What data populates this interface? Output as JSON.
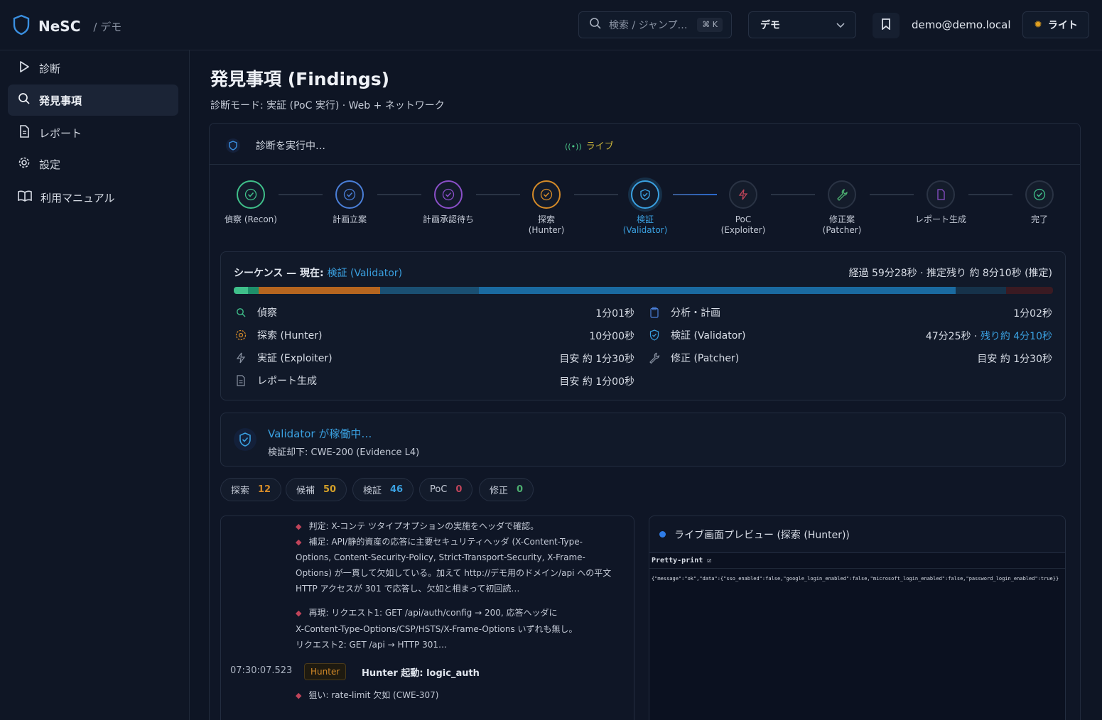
{
  "brand": {
    "name": "NeSC",
    "crumb": "/ デモ"
  },
  "search": {
    "placeholder": "検索 / ジャンプ…",
    "shortcut": "⌘ K"
  },
  "env": {
    "selected": "デモ"
  },
  "user": {
    "email": "demo@demo.local"
  },
  "theme": {
    "label": "ライト"
  },
  "sidebar": {
    "items": [
      {
        "label": "診断",
        "icon": "play-icon"
      },
      {
        "label": "発見事項",
        "icon": "search-icon",
        "active": true
      },
      {
        "label": "レポート",
        "icon": "document-icon"
      },
      {
        "label": "設定",
        "icon": "gear-icon"
      },
      {
        "label": "利用マニュアル",
        "icon": "book-icon"
      }
    ]
  },
  "page": {
    "title": "発見事項 (Findings)",
    "subtitle": "診断モード: 実証 (PoC 実行) · Web + ネットワーク"
  },
  "run": {
    "title": "診断を実行中…",
    "live_label": "ライブ"
  },
  "steps": [
    {
      "label": "偵察 (Recon)",
      "state": "done",
      "color": "#3fbf8a"
    },
    {
      "label": "計画立案",
      "state": "done",
      "color": "#4a7fd8"
    },
    {
      "label": "計画承認待ち",
      "state": "done",
      "color": "#8a4fc8"
    },
    {
      "label": "探索\n(Hunter)",
      "state": "done",
      "color": "#d48a28"
    },
    {
      "label": "検証\n(Validator)",
      "state": "active",
      "color": "#3aa0e0"
    },
    {
      "label": "PoC\n(Exploiter)",
      "state": "pending",
      "color": "#c0445a"
    },
    {
      "label": "修正案\n(Patcher)",
      "state": "pending",
      "color": "#4caf70"
    },
    {
      "label": "レポート生成",
      "state": "pending",
      "color": "#8a4fc8"
    },
    {
      "label": "完了",
      "state": "pending",
      "color": "#3fbf8a"
    }
  ],
  "sequence": {
    "title_prefix": "シーケンス — 現在:",
    "current": "検証 (Validator)",
    "elapsed": "経過 59分28秒 · 推定残り 約 8分10秒 (推定)",
    "segments": [
      {
        "color": "#3fbf8a",
        "share": 0.017
      },
      {
        "color": "#1d8f6a",
        "share": 0.013
      },
      {
        "color": "#b5651f",
        "share": 0.149
      },
      {
        "color": "#1a4f72",
        "share": 0.12
      },
      {
        "color": "#1a6aa0",
        "share": 0.582
      },
      {
        "color": "#16324a",
        "share": 0.062
      },
      {
        "color": "#3a1a22",
        "share": 0.057
      }
    ],
    "phases_left": [
      {
        "label": "偵察",
        "icon": "search-icon",
        "color": "#3fbf8a",
        "duration": "1分01秒"
      },
      {
        "label": "探索 (Hunter)",
        "icon": "radar-icon",
        "color": "#d48a28",
        "duration": "10分00秒"
      },
      {
        "label": "実証 (Exploiter)",
        "icon": "bolt-icon",
        "color": "#8a93a3",
        "duration": "目安 約 1分30秒"
      },
      {
        "label": "レポート生成",
        "icon": "document-icon",
        "color": "#8a93a3",
        "duration": "目安 約 1分00秒"
      }
    ],
    "phases_right": [
      {
        "label": "分析・計画",
        "icon": "clipboard-icon",
        "color": "#4a7fd8",
        "duration": "1分02秒"
      },
      {
        "label": "検証 (Validator)",
        "icon": "shield-icon",
        "color": "#3aa0e0",
        "duration": "47分25秒 · ",
        "remaining": "残り約 4分10秒"
      },
      {
        "label": "修正 (Patcher)",
        "icon": "wrench-icon",
        "color": "#8a93a3",
        "duration": "目安 約 1分30秒"
      }
    ]
  },
  "validator": {
    "title": "Validator が稼働中…",
    "sub": "検証却下: CWE-200 (Evidence L4)"
  },
  "counters": [
    {
      "label": "探索",
      "value": "12",
      "color": "#d48a28"
    },
    {
      "label": "候補",
      "value": "50",
      "color": "#d4a028"
    },
    {
      "label": "検証",
      "value": "46",
      "color": "#3aa0e0"
    },
    {
      "label": "PoC",
      "value": "0",
      "color": "#c0445a"
    },
    {
      "label": "修正",
      "value": "0",
      "color": "#4caf70"
    }
  ],
  "log": {
    "lines": [
      "判定: X-コンテ ツタイプオプションの実施をヘッダで確認。",
      "補足: API/静的資産の応答に主要セキュリティヘッダ (X-Content-Type-",
      "Options, Content-Security-Policy, Strict-Transport-Security, X-Frame-",
      "Options) が一貫して欠如している。加えて http://デモ用のドメイン/api への平文",
      "HTTP アクセスが 301 で応答し、欠如と相まって初回読…",
      "再現: リクエスト1: GET /api/auth/config → 200, 応答ヘッダに",
      "X-Content-Type-Options/CSP/HSTS/X-Frame-Options いずれも無し。",
      "リクエスト2: GET /api → HTTP 301…"
    ],
    "event_time": "07:30:07.523",
    "event_tag": "Hunter",
    "event_text": "Hunter 起動: logic_auth",
    "last_line": "狙い: rate-limit 欠如 (CWE-307)"
  },
  "preview": {
    "title": "ライブ画面プレビュー (探索 (Hunter))",
    "pretty_print": "Pretty-print ☑",
    "json": "{\"message\":\"ok\",\"data\":{\"sso_enabled\":false,\"google_login_enabled\":false,\"microsoft_login_enabled\":false,\"password_login_enabled\":true}}"
  }
}
